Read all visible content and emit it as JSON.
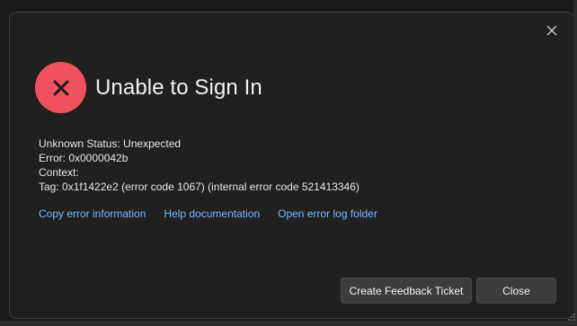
{
  "dialog": {
    "title": "Unable to Sign In",
    "details": {
      "status": "Unknown Status: Unexpected",
      "error": "Error: 0x0000042b",
      "context": "Context:",
      "tag": "Tag: 0x1f1422e2 (error code 1067) (internal error code 521413346)"
    },
    "links": {
      "copy_error": "Copy error information",
      "help_docs": "Help documentation",
      "open_log": "Open error log folder"
    },
    "buttons": {
      "feedback": "Create Feedback Ticket",
      "close": "Close"
    },
    "icons": {
      "status": "error-x-icon",
      "close": "close-icon",
      "grip": "resize-grip-icon"
    },
    "colors": {
      "error_badge": "#f0515f",
      "link": "#79b8ff",
      "dialog_bg": "#202020"
    }
  }
}
